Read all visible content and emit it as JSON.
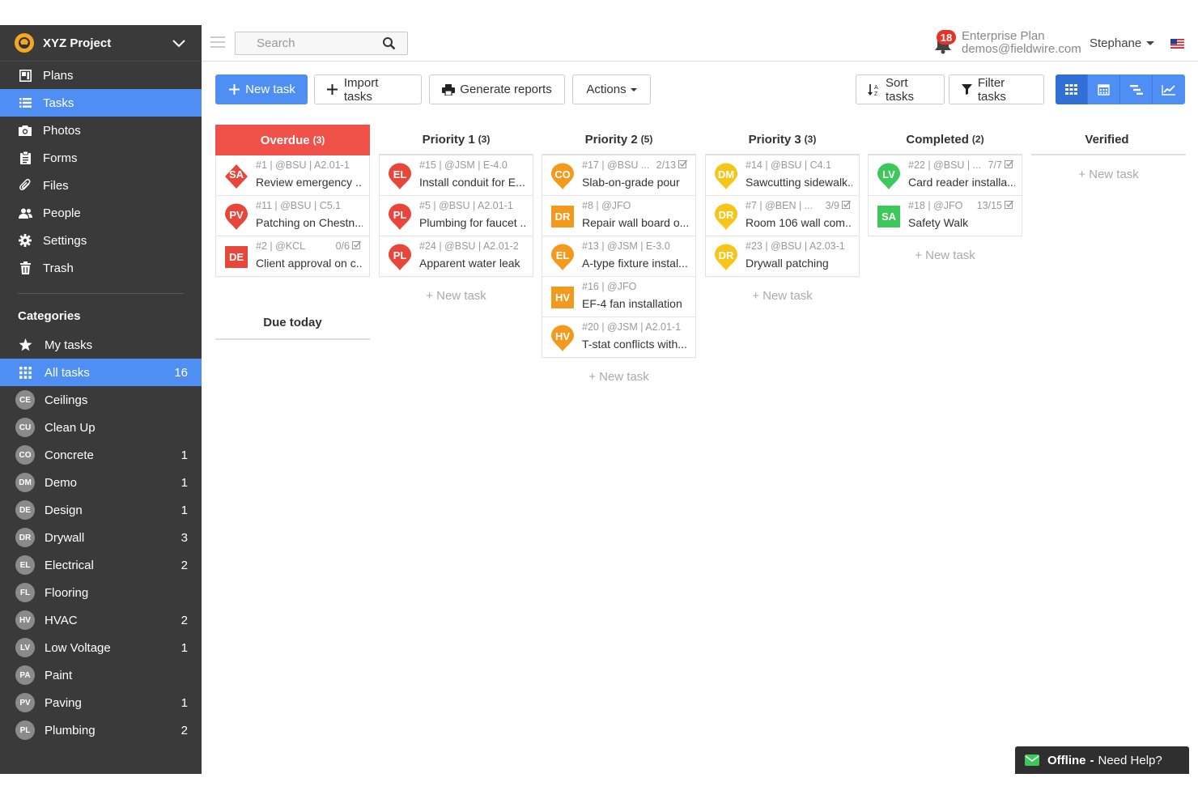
{
  "project": {
    "name": "XYZ Project"
  },
  "nav": [
    {
      "label": "Plans",
      "icon": "plans-icon"
    },
    {
      "label": "Tasks",
      "icon": "tasks-icon",
      "active": true
    },
    {
      "label": "Photos",
      "icon": "camera-icon"
    },
    {
      "label": "Forms",
      "icon": "forms-icon"
    },
    {
      "label": "Files",
      "icon": "paperclip-icon"
    },
    {
      "label": "People",
      "icon": "people-icon"
    },
    {
      "label": "Settings",
      "icon": "gear-icon"
    },
    {
      "label": "Trash",
      "icon": "trash-icon"
    }
  ],
  "categories": {
    "title": "Categories",
    "items": [
      {
        "label": "My tasks",
        "icon": "star-icon",
        "count": ""
      },
      {
        "label": "All tasks",
        "icon": "grid-icon",
        "count": "16",
        "active": true
      },
      {
        "badge": "CE",
        "label": "Ceilings",
        "count": ""
      },
      {
        "badge": "CU",
        "label": "Clean Up",
        "count": ""
      },
      {
        "badge": "CO",
        "label": "Concrete",
        "count": "1"
      },
      {
        "badge": "DM",
        "label": "Demo",
        "count": "1"
      },
      {
        "badge": "DE",
        "label": "Design",
        "count": "1"
      },
      {
        "badge": "DR",
        "label": "Drywall",
        "count": "3"
      },
      {
        "badge": "EL",
        "label": "Electrical",
        "count": "2"
      },
      {
        "badge": "FL",
        "label": "Flooring",
        "count": ""
      },
      {
        "badge": "HV",
        "label": "HVAC",
        "count": "2"
      },
      {
        "badge": "LV",
        "label": "Low Voltage",
        "count": "1"
      },
      {
        "badge": "PA",
        "label": "Paint",
        "count": ""
      },
      {
        "badge": "PV",
        "label": "Paving",
        "count": "1"
      },
      {
        "badge": "PL",
        "label": "Plumbing",
        "count": "2"
      }
    ]
  },
  "header": {
    "search_placeholder": "Search",
    "notifications": "18",
    "plan": "Enterprise Plan",
    "email": "demos@fieldwire.com",
    "user": "Stephane"
  },
  "toolbar": {
    "new_task": "New task",
    "import_tasks": "Import tasks",
    "generate_reports": "Generate reports",
    "actions": "Actions",
    "sort_tasks": "Sort tasks",
    "filter_tasks": "Filter tasks"
  },
  "colors": {
    "accent": "#4f8ff3",
    "overdue": "#f0524a",
    "red": "#e8463b",
    "orange": "#f39a1e",
    "yellow": "#f5c518",
    "green": "#3cc85a",
    "sidebar": "#3a3a3a"
  },
  "columns": [
    {
      "title": "Overdue",
      "count": "(3)",
      "style": "overdue",
      "cards": [
        {
          "badge": "SA",
          "shape": "diamond",
          "color": "#e8463b",
          "meta": "#1 | @BSU | A2.01-1",
          "check": "",
          "title": "Review emergency ..."
        },
        {
          "badge": "PV",
          "shape": "pin",
          "color": "#e8463b",
          "meta": "#11 | @BSU | C5.1",
          "check": "",
          "title": "Patching on Chestn..."
        },
        {
          "badge": "DE",
          "shape": "square",
          "color": "#e8463b",
          "meta": "#2 | @KCL",
          "check": "0/6",
          "title": "Client approval on c..."
        }
      ],
      "new_task": ""
    },
    {
      "title": "Priority 1",
      "count": "(3)",
      "style": "normal",
      "cards": [
        {
          "badge": "EL",
          "shape": "pin",
          "color": "#e8463b",
          "meta": "#15 | @JSM | E-4.0",
          "check": "",
          "title": "Install conduit for E..."
        },
        {
          "badge": "PL",
          "shape": "pin",
          "color": "#e8463b",
          "meta": "#5 | @BSU | A2.01-1",
          "check": "",
          "title": "Plumbing for faucet ..."
        },
        {
          "badge": "PL",
          "shape": "pin",
          "color": "#e8463b",
          "meta": "#24 | @BSU | A2.01-2",
          "check": "",
          "title": "Apparent water leak"
        }
      ],
      "new_task": "+ New task"
    },
    {
      "title": "Priority 2",
      "count": "(5)",
      "style": "normal",
      "cards": [
        {
          "badge": "CO",
          "shape": "pin",
          "color": "#f39a1e",
          "meta": "#17 | @BSU ...",
          "check": "2/13",
          "title": "Slab-on-grade pour"
        },
        {
          "badge": "DR",
          "shape": "square",
          "color": "#f39a1e",
          "meta": "#8 | @JFO",
          "check": "",
          "title": "Repair wall board o..."
        },
        {
          "badge": "EL",
          "shape": "pin",
          "color": "#f39a1e",
          "meta": "#13 | @JSM | E-3.0",
          "check": "",
          "title": "A-type fixture instal..."
        },
        {
          "badge": "HV",
          "shape": "square",
          "color": "#f39a1e",
          "meta": "#16 | @JFO",
          "check": "",
          "title": "EF-4 fan installation"
        },
        {
          "badge": "HV",
          "shape": "pin",
          "color": "#f39a1e",
          "meta": "#20 | @JSM | A2.01-1",
          "check": "",
          "title": "T-stat conflicts with..."
        }
      ],
      "new_task": "+ New task"
    },
    {
      "title": "Priority 3",
      "count": "(3)",
      "style": "normal",
      "cards": [
        {
          "badge": "DM",
          "shape": "pin",
          "color": "#f5c518",
          "meta": "#14 | @BSU | C4.1",
          "check": "",
          "title": "Sawcutting sidewalk..."
        },
        {
          "badge": "DR",
          "shape": "pin",
          "color": "#f5c518",
          "meta": "#7 | @BEN | ...",
          "check": "3/9",
          "title": "Room 106 wall com..."
        },
        {
          "badge": "DR",
          "shape": "pin",
          "color": "#f5c518",
          "meta": "#23 | @BSU | A2.03-1",
          "check": "",
          "title": "Drywall patching"
        }
      ],
      "new_task": "+ New task"
    },
    {
      "title": "Completed",
      "count": "(2)",
      "style": "normal",
      "cards": [
        {
          "badge": "LV",
          "shape": "pin",
          "color": "#3cc85a",
          "meta": "#22 | @BSU | ...",
          "check": "7/7",
          "title": "Card reader installa..."
        },
        {
          "badge": "SA",
          "shape": "square",
          "color": "#3cc85a",
          "meta": "#18 | @JFO",
          "check": "13/15",
          "title": "Safety Walk"
        }
      ],
      "new_task": "+ New task"
    },
    {
      "title": "Verified",
      "count": "",
      "style": "normal",
      "cards": [],
      "new_task": "+ New task"
    }
  ],
  "due_today": "Due today",
  "help": {
    "status": "Offline",
    "sep": "-",
    "text": "Need Help?"
  }
}
